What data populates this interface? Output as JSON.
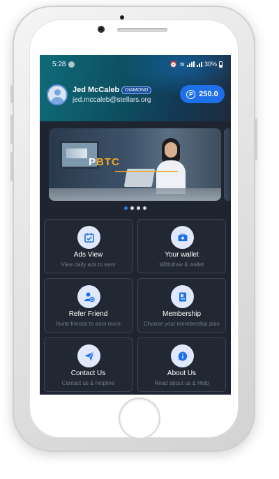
{
  "status_bar": {
    "time": "5:28",
    "battery": "30%"
  },
  "profile": {
    "name": "Jed McCaleb",
    "badge": "DIAMOND",
    "email": "jed.mccaleb@stellars.org",
    "avatar_icon": "user-avatar-icon"
  },
  "coins": {
    "icon": "coin-icon",
    "icon_glyph": "P",
    "value": "250.0"
  },
  "banner": {
    "logo_text": "PBTC",
    "carousel_dots": 4,
    "active_dot": 0
  },
  "menu": [
    {
      "title": "Ads View",
      "subtitle": "View daily ads to earn",
      "icon": "calendar-check-icon"
    },
    {
      "title": "Your wallet",
      "subtitle": "Withdraw & wallet",
      "icon": "wallet-icon"
    },
    {
      "title": "Refer Friend",
      "subtitle": "Invite friends to earn more",
      "icon": "add-user-icon"
    },
    {
      "title": "Membership",
      "subtitle": "Choose your membership plan",
      "icon": "membership-card-icon"
    },
    {
      "title": "Contact Us",
      "subtitle": "Contact us & helpline",
      "icon": "send-icon"
    },
    {
      "title": "About Us",
      "subtitle": "Read about us & Help",
      "icon": "info-chat-icon"
    }
  ],
  "colors": {
    "accent": "#1e6fe8",
    "screen_bg": "#1f2530",
    "tile_border": "#3b4451",
    "icon_bg": "#dfe9fb",
    "icon_fg": "#1e6fe8"
  }
}
